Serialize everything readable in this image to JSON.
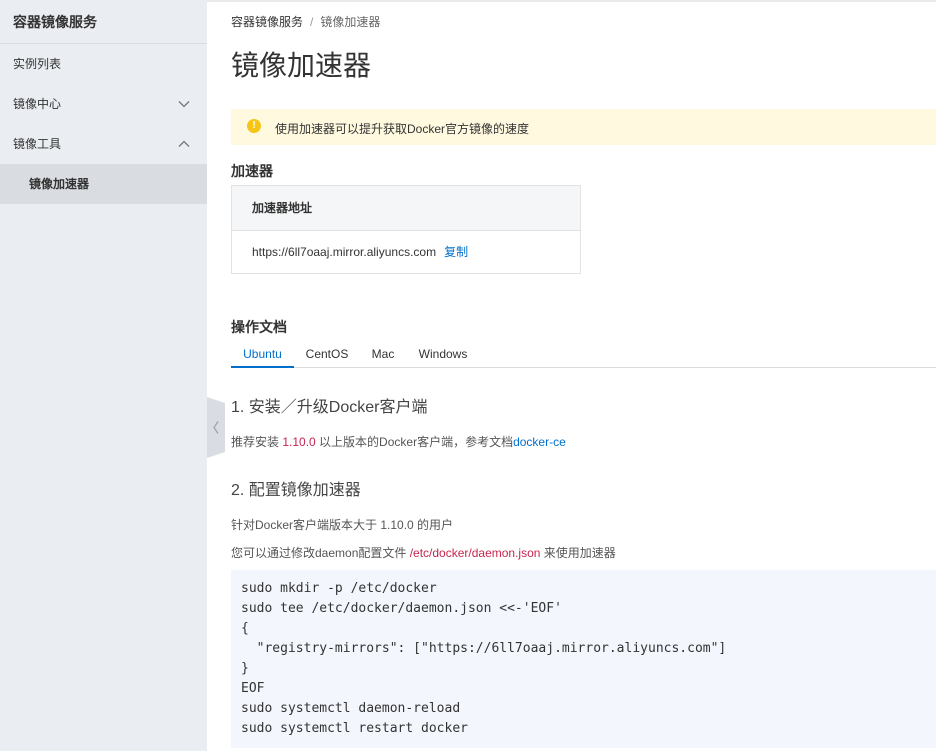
{
  "sidebar": {
    "title": "容器镜像服务",
    "items": [
      {
        "label": "实例列表"
      },
      {
        "label": "镜像中心"
      },
      {
        "label": "镜像工具"
      }
    ],
    "sub_item": "镜像加速器"
  },
  "breadcrumb": {
    "parent": "容器镜像服务",
    "separator": "/",
    "current": "镜像加速器"
  },
  "page_title": "镜像加速器",
  "notice": {
    "icon": "warning-icon",
    "text": "使用加速器可以提升获取Docker官方镜像的速度"
  },
  "accelerator": {
    "section_title": "加速器",
    "column_header": "加速器地址",
    "address": "https://6ll7oaaj.mirror.aliyuncs.com",
    "copy_label": "复制"
  },
  "docs": {
    "section_title": "操作文档",
    "tabs": [
      {
        "label": "Ubuntu",
        "active": true
      },
      {
        "label": "CentOS",
        "active": false
      },
      {
        "label": "Mac",
        "active": false
      },
      {
        "label": "Windows",
        "active": false
      }
    ],
    "step1": {
      "heading": "1. 安装／升级Docker客户端",
      "text_before": "推荐安装 ",
      "version": "1.10.0",
      "text_mid": " 以上版本的Docker客户端，参考文档",
      "link": "docker-ce"
    },
    "step2": {
      "heading": "2. 配置镜像加速器",
      "line1": "针对Docker客户端版本大于 1.10.0 的用户",
      "line2_before": "您可以通过修改daemon配置文件 ",
      "config_path": "/etc/docker/daemon.json",
      "line2_after": " 来使用加速器"
    },
    "code": "sudo mkdir -p /etc/docker\nsudo tee /etc/docker/daemon.json <<-'EOF'\n{\n  \"registry-mirrors\": [\"https://6ll7oaaj.mirror.aliyuncs.com\"]\n}\nEOF\nsudo systemctl daemon-reload\nsudo systemctl restart docker"
  },
  "colors": {
    "accent": "#0070cc",
    "warning": "#f5c518",
    "notice_bg": "#fff9e0",
    "code_highlight": "#c7254e",
    "sidebar_bg": "#eaedf1"
  }
}
